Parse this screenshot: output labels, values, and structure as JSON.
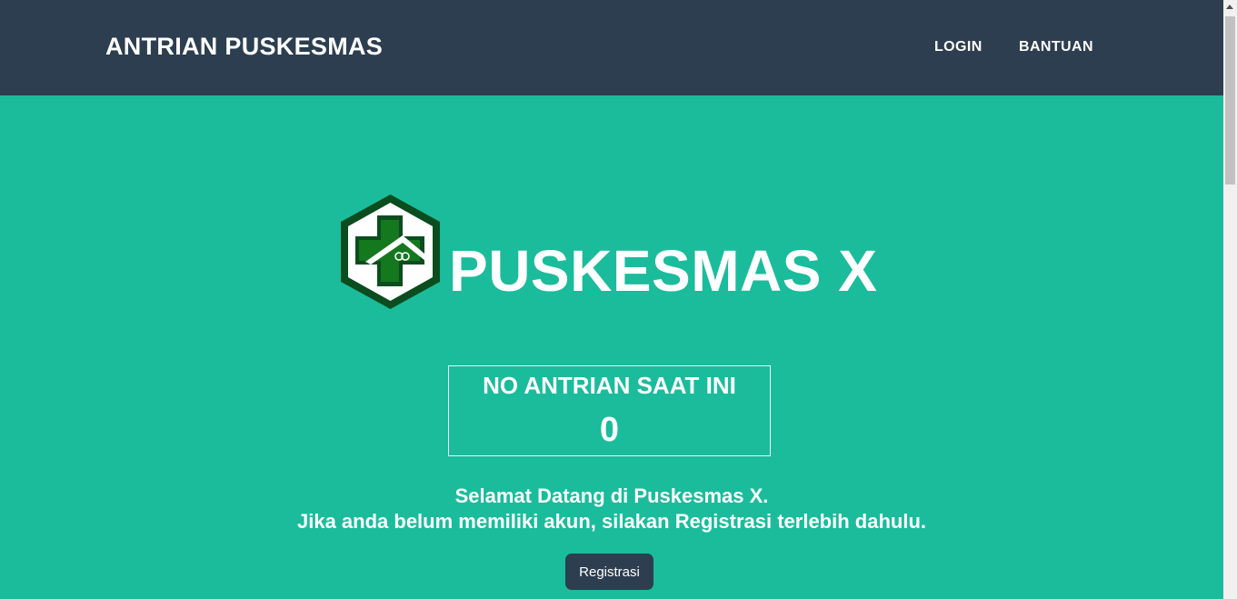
{
  "navbar": {
    "brand": "ANTRIAN PUSKESMAS",
    "links": [
      {
        "label": "LOGIN"
      },
      {
        "label": "BANTUAN"
      }
    ]
  },
  "hero": {
    "logo_icon": "puskesmas-logo-icon",
    "title": "PUSKESMAS X"
  },
  "queue": {
    "label": "NO ANTRIAN SAAT INI",
    "number": "0"
  },
  "welcome": {
    "line1": "Selamat Datang di Puskesmas X.",
    "line2": "Jika anda belum memiliki akun, silakan Registrasi terlebih dahulu."
  },
  "actions": {
    "register_label": "Registrasi"
  },
  "colors": {
    "navbar_bg": "#2c3e50",
    "page_bg": "#1abc9c",
    "logo_green_dark": "#0b4d1e",
    "logo_green": "#14781e"
  }
}
